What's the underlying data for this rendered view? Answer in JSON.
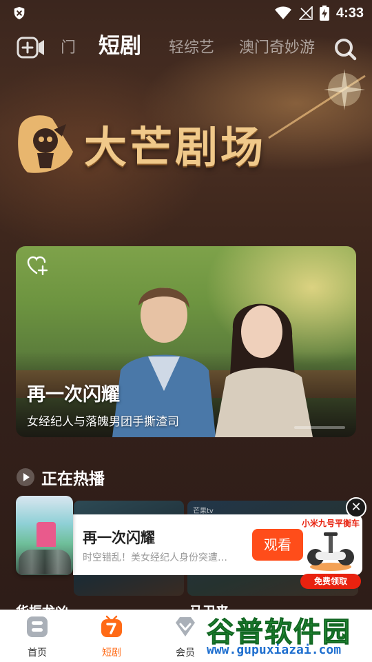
{
  "status_bar": {
    "time": "4:33"
  },
  "top_nav": {
    "tabs": [
      {
        "label": "门",
        "active": false
      },
      {
        "label": "短剧",
        "active": true
      },
      {
        "label": "轻综艺",
        "active": false
      },
      {
        "label": "澳门奇妙游",
        "active": false
      }
    ]
  },
  "brand": {
    "title": "大芒剧场"
  },
  "featured": {
    "title": "再一次闪耀",
    "subtitle": "女经纪人与落魄男团手撕渣司"
  },
  "section": {
    "title": "正在热播"
  },
  "row_labels": {
    "left": "华振龙凶",
    "right": "马卫来"
  },
  "ad": {
    "title": "再一次闪耀",
    "description": "时空错乱！美女经纪人身份突遭…",
    "button": "观看",
    "close": "✕",
    "promo_title": "小米九号平衡车",
    "promo_button": "免费领取"
  },
  "bottom_nav": {
    "items": [
      {
        "label": "首页",
        "active": false
      },
      {
        "label": "短剧",
        "active": true
      },
      {
        "label": "会员",
        "active": false
      }
    ]
  },
  "watermark": {
    "main": "谷普软件园",
    "url": "www.gupuxiazai.com"
  },
  "colors": {
    "accent": "#ff6a16",
    "ad_button": "#ff4d1a",
    "brand_gold": "#f0c98a"
  }
}
